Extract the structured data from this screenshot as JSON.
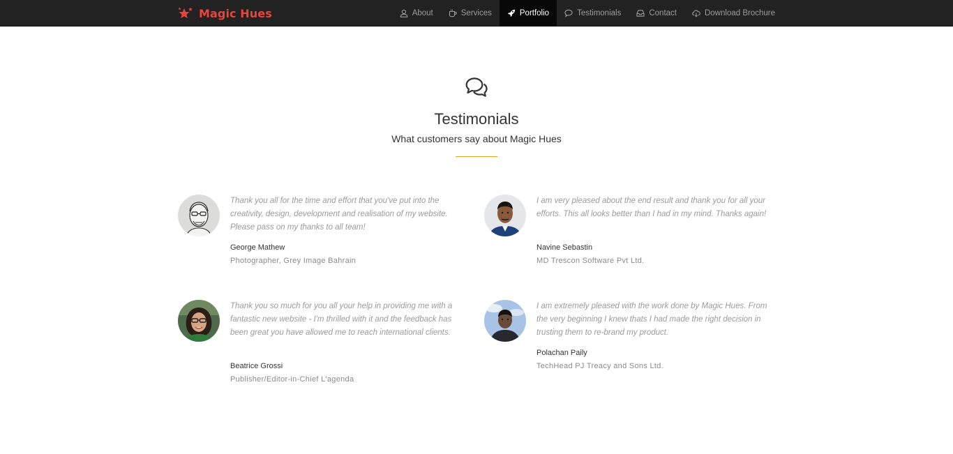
{
  "brand": {
    "name": "Magic Hues",
    "color": "#e8453c"
  },
  "nav": {
    "items": [
      {
        "label": "About",
        "icon": "user-icon"
      },
      {
        "label": "Services",
        "icon": "coffee-cup-icon"
      },
      {
        "label": "Portfolio",
        "icon": "rocket-icon",
        "active": true
      },
      {
        "label": "Testimonials",
        "icon": "speech-bubble-icon"
      },
      {
        "label": "Contact",
        "icon": "inbox-icon"
      },
      {
        "label": "Download Brochure",
        "icon": "cloud-download-icon"
      }
    ]
  },
  "section": {
    "icon": "chat-bubbles-icon",
    "title": "Testimonials",
    "subtitle": "What customers say about Magic Hues",
    "accent": "#e0a320"
  },
  "testimonials": [
    {
      "quote": "Thank you all for the time and effort that you've put into the creativity, design, development and realisation of my website. Please pass on my thanks to all team!",
      "author": "George Mathew",
      "role": "Photographer, Grey Image Bahrain",
      "avatar": "sketch-portrait-avatar"
    },
    {
      "quote": "I am very pleased about the end result and thank you for all your efforts. This all looks better than I had in my mind. Thanks again!",
      "author": "Navine Sebastin",
      "role": "MD Trescon Software Pvt Ltd.",
      "avatar": "man-portrait-avatar"
    },
    {
      "quote": "Thank you so much for you all your help in providing me with a fantastic new website - I'm thrilled with it and the feedback has been great you have allowed me to reach international clients.",
      "author": "Beatrice Grossi",
      "role": "Publisher/Editor-in-Chief L'agenda",
      "avatar": "woman-glasses-avatar"
    },
    {
      "quote": "I am extremely pleased with the work done by Magic Hues. From the very beginning I knew thats I had made the right decision in trusting them to re-brand my product.",
      "author": "Polachan Paily",
      "role": "TechHead PJ Treacy and Sons Ltd.",
      "avatar": "man-outdoor-avatar"
    }
  ]
}
